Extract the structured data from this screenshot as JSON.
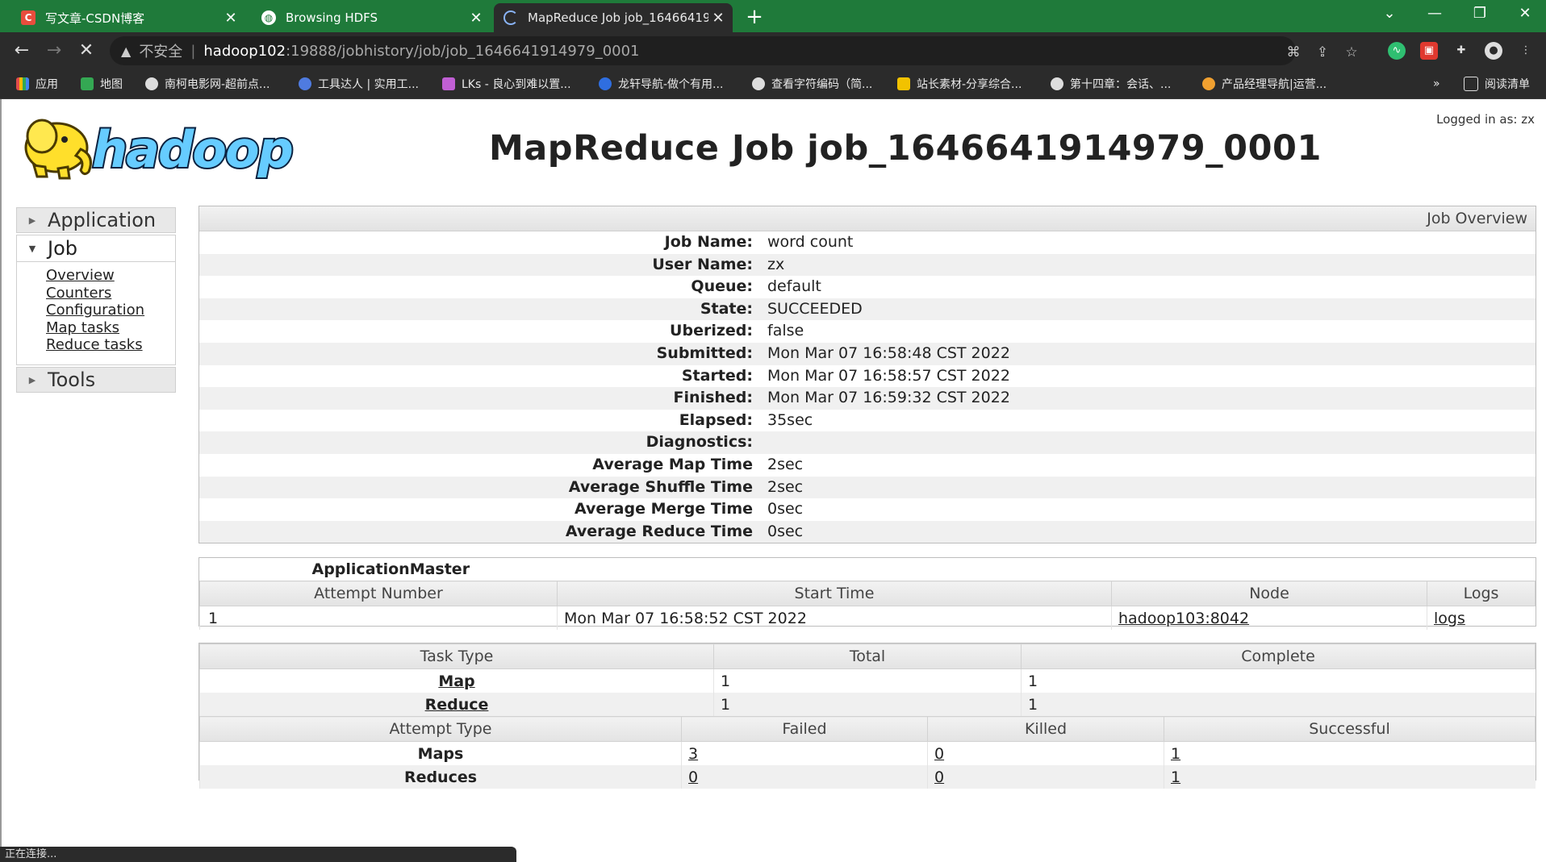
{
  "tabs": [
    {
      "title": "写文章-CSDN博客",
      "favicon": "C"
    },
    {
      "title": "Browsing HDFS"
    },
    {
      "title": "MapReduce Job job_16466419"
    }
  ],
  "address": {
    "security_label": "不安全",
    "host": "hadoop102",
    "path": ":19888/jobhistory/job/job_1646641914979_0001"
  },
  "bookmarks": [
    {
      "label": "应用",
      "color": "#e34b4b"
    },
    {
      "label": "地图",
      "color": "#34a853"
    },
    {
      "label": "南柯电影网-超前点...",
      "color": "#dddddd"
    },
    {
      "label": "工具达人 | 实用工...",
      "color": "#4f7be0"
    },
    {
      "label": "LKs - 良心到难以置...",
      "color": "#c05fd4"
    },
    {
      "label": "龙轩导航-做个有用...",
      "color": "#2f6ee0"
    },
    {
      "label": "查看字符编码（简...",
      "color": "#dddddd"
    },
    {
      "label": "站长素材-分享综合...",
      "color": "#f2c200"
    },
    {
      "label": "第十四章：会话、...",
      "color": "#dddddd"
    },
    {
      "label": "产品经理导航|运营...",
      "color": "#f0a030"
    }
  ],
  "reading_list": "阅读清单",
  "bookmarks_more": "»",
  "page": {
    "logo_text": "hadoop",
    "heading": "MapReduce Job job_1646641914979_0001",
    "logged_in": "Logged in as: zx"
  },
  "sidebar": {
    "application": "Application",
    "job": "Job",
    "job_links": [
      "Overview",
      "Counters",
      "Configuration",
      "Map tasks",
      "Reduce tasks"
    ],
    "tools": "Tools"
  },
  "overview": {
    "header": "Job Overview",
    "rows": [
      {
        "label": "Job Name:",
        "value": "word count"
      },
      {
        "label": "User Name:",
        "value": "zx"
      },
      {
        "label": "Queue:",
        "value": "default"
      },
      {
        "label": "State:",
        "value": "SUCCEEDED"
      },
      {
        "label": "Uberized:",
        "value": "false"
      },
      {
        "label": "Submitted:",
        "value": "Mon Mar 07 16:58:48 CST 2022"
      },
      {
        "label": "Started:",
        "value": "Mon Mar 07 16:58:57 CST 2022"
      },
      {
        "label": "Finished:",
        "value": "Mon Mar 07 16:59:32 CST 2022"
      },
      {
        "label": "Elapsed:",
        "value": "35sec"
      },
      {
        "label": "Diagnostics:",
        "value": ""
      },
      {
        "label": "Average Map Time",
        "value": "2sec"
      },
      {
        "label": "Average Shuffle Time",
        "value": "2sec"
      },
      {
        "label": "Average Merge Time",
        "value": "0sec"
      },
      {
        "label": "Average Reduce Time",
        "value": "0sec"
      }
    ]
  },
  "am": {
    "title": "ApplicationMaster",
    "columns": [
      "Attempt Number",
      "Start Time",
      "Node",
      "Logs"
    ],
    "row": {
      "attempt": "1",
      "start": "Mon Mar 07 16:58:52 CST 2022",
      "node": "hadoop103:8042",
      "logs": "logs"
    }
  },
  "tasks": {
    "columns": [
      "Task Type",
      "Total",
      "Complete"
    ],
    "rows": [
      {
        "type": "Map",
        "total": "1",
        "complete": "1"
      },
      {
        "type": "Reduce",
        "total": "1",
        "complete": "1"
      }
    ],
    "attempt_columns": [
      "Attempt Type",
      "Failed",
      "Killed",
      "Successful"
    ],
    "attempt_rows": [
      {
        "type": "Maps",
        "failed": "3",
        "killed": "0",
        "successful": "1"
      },
      {
        "type": "Reduces",
        "failed": "0",
        "killed": "0",
        "successful": "1"
      }
    ]
  },
  "status_bar": "正在连接..."
}
